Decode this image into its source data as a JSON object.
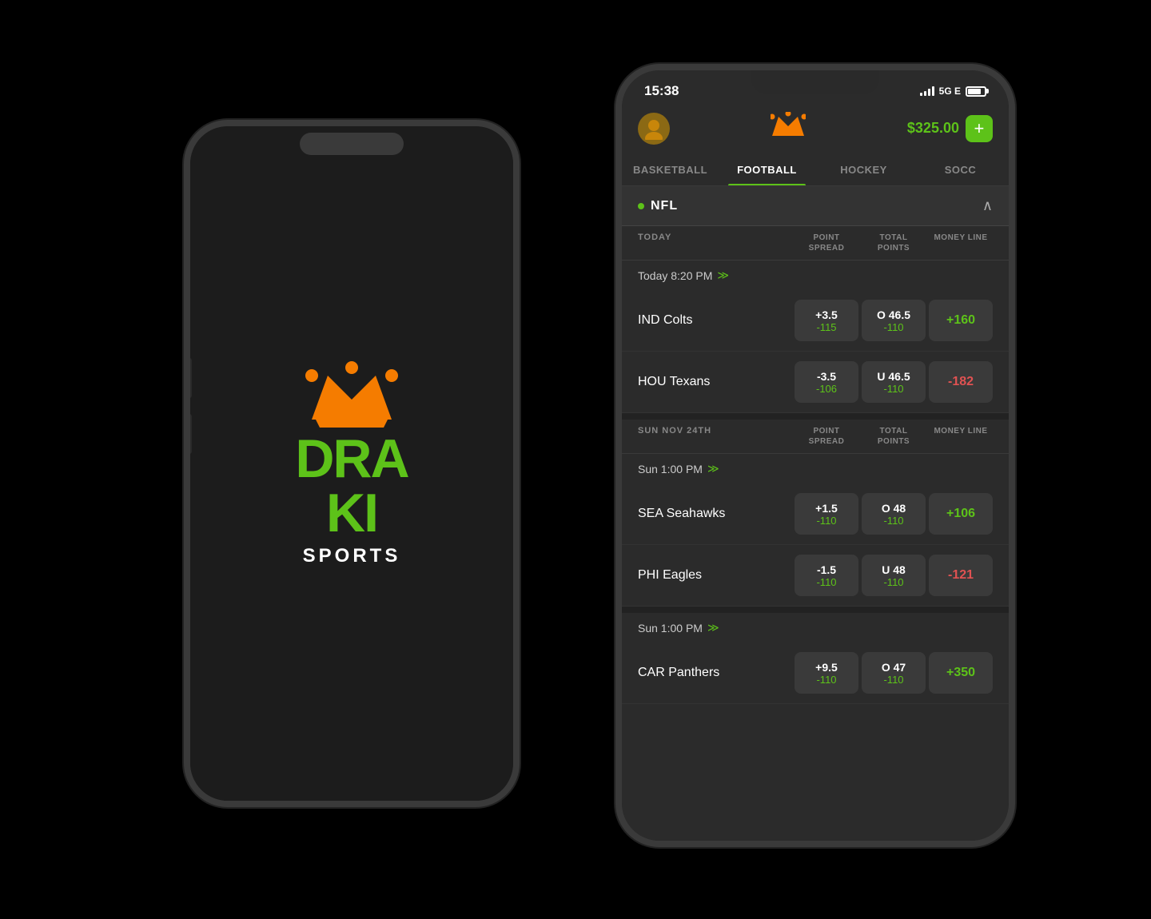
{
  "scene": {
    "background": "#000"
  },
  "back_phone": {
    "logo": {
      "crown": "👑",
      "text_line1": "DRA",
      "text_line2": "KI",
      "sports": "SPORTS"
    }
  },
  "front_phone": {
    "status_bar": {
      "time": "15:38",
      "signal": "5G E",
      "battery": "80"
    },
    "header": {
      "balance": "$325.00",
      "add_label": "+"
    },
    "sport_tabs": [
      {
        "label": "BASKETBALL",
        "active": false
      },
      {
        "label": "FOOTBALL",
        "active": true
      },
      {
        "label": "HOCKEY",
        "active": false
      },
      {
        "label": "SOCC",
        "active": false
      }
    ],
    "league": {
      "name": "NFL",
      "dot_color": "#5dc219"
    },
    "table": {
      "section1": {
        "header_label": "TODAY",
        "col1": "POINT\nSPREAD",
        "col2": "TOTAL\nPOINTS",
        "col3": "MONEY LINE"
      },
      "game_time1": "Today 8:20 PM",
      "games_today": [
        {
          "team": "IND Colts",
          "spread_main": "+3.5",
          "spread_sub": "-115",
          "total_main": "O 46.5",
          "total_sub": "-110",
          "money": "+160",
          "money_positive": true
        },
        {
          "team": "HOU Texans",
          "spread_main": "-3.5",
          "spread_sub": "-106",
          "total_main": "U 46.5",
          "total_sub": "-110",
          "money": "-182",
          "money_positive": false
        }
      ],
      "section2": {
        "header_label": "SUN NOV 24TH",
        "col1": "POINT\nSPREAD",
        "col2": "TOTAL\nPOINTS",
        "col3": "MONEY LINE"
      },
      "game_time2": "Sun 1:00 PM",
      "games_sun1": [
        {
          "team": "SEA Seahawks",
          "spread_main": "+1.5",
          "spread_sub": "-110",
          "total_main": "O 48",
          "total_sub": "-110",
          "money": "+106",
          "money_positive": true
        },
        {
          "team": "PHI Eagles",
          "spread_main": "-1.5",
          "spread_sub": "-110",
          "total_main": "U 48",
          "total_sub": "-110",
          "money": "-121",
          "money_positive": false
        }
      ],
      "game_time3": "Sun 1:00 PM",
      "games_sun2": [
        {
          "team": "CAR Panthers",
          "spread_main": "+9.5",
          "spread_sub": "-110",
          "total_main": "O 47",
          "total_sub": "-110",
          "money": "+350",
          "money_positive": true
        }
      ]
    }
  }
}
